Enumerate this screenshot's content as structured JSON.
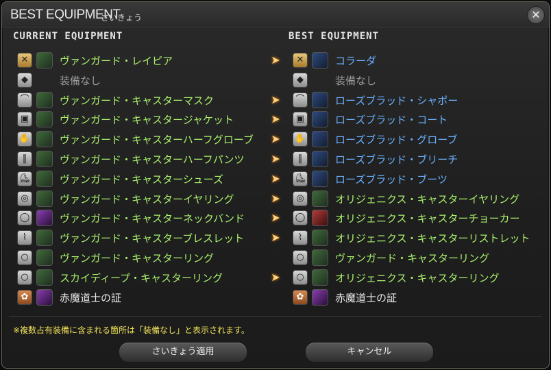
{
  "window": {
    "title": "BEST EQUIPMENT",
    "subtitle": "さいきょう",
    "close_icon": "close-gear-icon"
  },
  "columns": {
    "current_header": "CURRENT EQUIPMENT",
    "best_header": "BEST EQUIPMENT"
  },
  "rows": [
    {
      "slot": "weapon",
      "current": {
        "name": "ヴァンガード・レイピア",
        "state": "green"
      },
      "arrow": true,
      "best": {
        "name": "コラーダ",
        "state": "blue"
      }
    },
    {
      "slot": "shield",
      "current": {
        "name": "装備なし",
        "state": "gray"
      },
      "arrow": false,
      "best": {
        "name": "装備なし",
        "state": "gray"
      }
    },
    {
      "slot": "head",
      "current": {
        "name": "ヴァンガード・キャスターマスク",
        "state": "green"
      },
      "arrow": true,
      "best": {
        "name": "ローズブラッド・シャポー",
        "state": "blue"
      }
    },
    {
      "slot": "body",
      "current": {
        "name": "ヴァンガード・キャスタージャケット",
        "state": "green"
      },
      "arrow": true,
      "best": {
        "name": "ローズブラッド・コート",
        "state": "blue"
      }
    },
    {
      "slot": "hands",
      "current": {
        "name": "ヴァンガード・キャスターハーフグローブ",
        "state": "green"
      },
      "arrow": true,
      "best": {
        "name": "ローズブラッド・グローブ",
        "state": "blue"
      }
    },
    {
      "slot": "legs",
      "current": {
        "name": "ヴァンガード・キャスターハーフパンツ",
        "state": "green"
      },
      "arrow": true,
      "best": {
        "name": "ローズブラッド・ブリーチ",
        "state": "blue"
      }
    },
    {
      "slot": "feet",
      "current": {
        "name": "ヴァンガード・キャスターシューズ",
        "state": "green"
      },
      "arrow": true,
      "best": {
        "name": "ローズブラッド・ブーツ",
        "state": "blue"
      }
    },
    {
      "slot": "earrings",
      "current": {
        "name": "ヴァンガード・キャスターイヤリング",
        "state": "green"
      },
      "arrow": true,
      "best": {
        "name": "オリジェニクス・キャスターイヤリング",
        "state": "green"
      }
    },
    {
      "slot": "necklace",
      "current": {
        "name": "ヴァンガード・キャスターネックバンド",
        "state": "green"
      },
      "arrow": true,
      "best": {
        "name": "オリジェニクス・キャスターチョーカー",
        "state": "green"
      }
    },
    {
      "slot": "bracelets",
      "current": {
        "name": "ヴァンガード・キャスターブレスレット",
        "state": "green"
      },
      "arrow": true,
      "best": {
        "name": "オリジェニクス・キャスターリストレット",
        "state": "green"
      }
    },
    {
      "slot": "ring",
      "current": {
        "name": "ヴァンガード・キャスターリング",
        "state": "green"
      },
      "arrow": false,
      "best": {
        "name": "ヴァンガード・キャスターリング",
        "state": "green"
      }
    },
    {
      "slot": "ring",
      "current": {
        "name": "スカイディープ・キャスターリング",
        "state": "green"
      },
      "arrow": true,
      "best": {
        "name": "オリジェニクス・キャスターリング",
        "state": "green"
      }
    },
    {
      "slot": "soul-crystal",
      "current": {
        "name": "赤魔道士の証",
        "state": "white"
      },
      "arrow": false,
      "best": {
        "name": "赤魔道士の証",
        "state": "white"
      }
    }
  ],
  "notice": "※複数占有装備に含まれる箇所は「装備なし」と表示されます。",
  "buttons": {
    "apply": "さいきょう適用",
    "cancel": "キャンセル"
  }
}
